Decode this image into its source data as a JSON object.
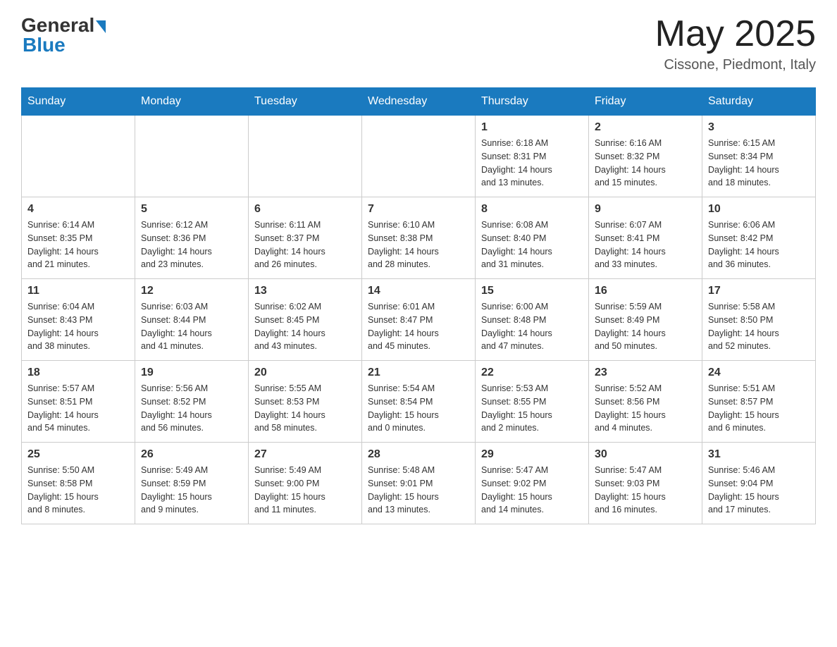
{
  "header": {
    "logo_text_general": "General",
    "logo_text_blue": "Blue",
    "month_title": "May 2025",
    "location": "Cissone, Piedmont, Italy"
  },
  "weekdays": [
    "Sunday",
    "Monday",
    "Tuesday",
    "Wednesday",
    "Thursday",
    "Friday",
    "Saturday"
  ],
  "weeks": [
    [
      {
        "day": "",
        "info": ""
      },
      {
        "day": "",
        "info": ""
      },
      {
        "day": "",
        "info": ""
      },
      {
        "day": "",
        "info": ""
      },
      {
        "day": "1",
        "info": "Sunrise: 6:18 AM\nSunset: 8:31 PM\nDaylight: 14 hours\nand 13 minutes."
      },
      {
        "day": "2",
        "info": "Sunrise: 6:16 AM\nSunset: 8:32 PM\nDaylight: 14 hours\nand 15 minutes."
      },
      {
        "day": "3",
        "info": "Sunrise: 6:15 AM\nSunset: 8:34 PM\nDaylight: 14 hours\nand 18 minutes."
      }
    ],
    [
      {
        "day": "4",
        "info": "Sunrise: 6:14 AM\nSunset: 8:35 PM\nDaylight: 14 hours\nand 21 minutes."
      },
      {
        "day": "5",
        "info": "Sunrise: 6:12 AM\nSunset: 8:36 PM\nDaylight: 14 hours\nand 23 minutes."
      },
      {
        "day": "6",
        "info": "Sunrise: 6:11 AM\nSunset: 8:37 PM\nDaylight: 14 hours\nand 26 minutes."
      },
      {
        "day": "7",
        "info": "Sunrise: 6:10 AM\nSunset: 8:38 PM\nDaylight: 14 hours\nand 28 minutes."
      },
      {
        "day": "8",
        "info": "Sunrise: 6:08 AM\nSunset: 8:40 PM\nDaylight: 14 hours\nand 31 minutes."
      },
      {
        "day": "9",
        "info": "Sunrise: 6:07 AM\nSunset: 8:41 PM\nDaylight: 14 hours\nand 33 minutes."
      },
      {
        "day": "10",
        "info": "Sunrise: 6:06 AM\nSunset: 8:42 PM\nDaylight: 14 hours\nand 36 minutes."
      }
    ],
    [
      {
        "day": "11",
        "info": "Sunrise: 6:04 AM\nSunset: 8:43 PM\nDaylight: 14 hours\nand 38 minutes."
      },
      {
        "day": "12",
        "info": "Sunrise: 6:03 AM\nSunset: 8:44 PM\nDaylight: 14 hours\nand 41 minutes."
      },
      {
        "day": "13",
        "info": "Sunrise: 6:02 AM\nSunset: 8:45 PM\nDaylight: 14 hours\nand 43 minutes."
      },
      {
        "day": "14",
        "info": "Sunrise: 6:01 AM\nSunset: 8:47 PM\nDaylight: 14 hours\nand 45 minutes."
      },
      {
        "day": "15",
        "info": "Sunrise: 6:00 AM\nSunset: 8:48 PM\nDaylight: 14 hours\nand 47 minutes."
      },
      {
        "day": "16",
        "info": "Sunrise: 5:59 AM\nSunset: 8:49 PM\nDaylight: 14 hours\nand 50 minutes."
      },
      {
        "day": "17",
        "info": "Sunrise: 5:58 AM\nSunset: 8:50 PM\nDaylight: 14 hours\nand 52 minutes."
      }
    ],
    [
      {
        "day": "18",
        "info": "Sunrise: 5:57 AM\nSunset: 8:51 PM\nDaylight: 14 hours\nand 54 minutes."
      },
      {
        "day": "19",
        "info": "Sunrise: 5:56 AM\nSunset: 8:52 PM\nDaylight: 14 hours\nand 56 minutes."
      },
      {
        "day": "20",
        "info": "Sunrise: 5:55 AM\nSunset: 8:53 PM\nDaylight: 14 hours\nand 58 minutes."
      },
      {
        "day": "21",
        "info": "Sunrise: 5:54 AM\nSunset: 8:54 PM\nDaylight: 15 hours\nand 0 minutes."
      },
      {
        "day": "22",
        "info": "Sunrise: 5:53 AM\nSunset: 8:55 PM\nDaylight: 15 hours\nand 2 minutes."
      },
      {
        "day": "23",
        "info": "Sunrise: 5:52 AM\nSunset: 8:56 PM\nDaylight: 15 hours\nand 4 minutes."
      },
      {
        "day": "24",
        "info": "Sunrise: 5:51 AM\nSunset: 8:57 PM\nDaylight: 15 hours\nand 6 minutes."
      }
    ],
    [
      {
        "day": "25",
        "info": "Sunrise: 5:50 AM\nSunset: 8:58 PM\nDaylight: 15 hours\nand 8 minutes."
      },
      {
        "day": "26",
        "info": "Sunrise: 5:49 AM\nSunset: 8:59 PM\nDaylight: 15 hours\nand 9 minutes."
      },
      {
        "day": "27",
        "info": "Sunrise: 5:49 AM\nSunset: 9:00 PM\nDaylight: 15 hours\nand 11 minutes."
      },
      {
        "day": "28",
        "info": "Sunrise: 5:48 AM\nSunset: 9:01 PM\nDaylight: 15 hours\nand 13 minutes."
      },
      {
        "day": "29",
        "info": "Sunrise: 5:47 AM\nSunset: 9:02 PM\nDaylight: 15 hours\nand 14 minutes."
      },
      {
        "day": "30",
        "info": "Sunrise: 5:47 AM\nSunset: 9:03 PM\nDaylight: 15 hours\nand 16 minutes."
      },
      {
        "day": "31",
        "info": "Sunrise: 5:46 AM\nSunset: 9:04 PM\nDaylight: 15 hours\nand 17 minutes."
      }
    ]
  ]
}
